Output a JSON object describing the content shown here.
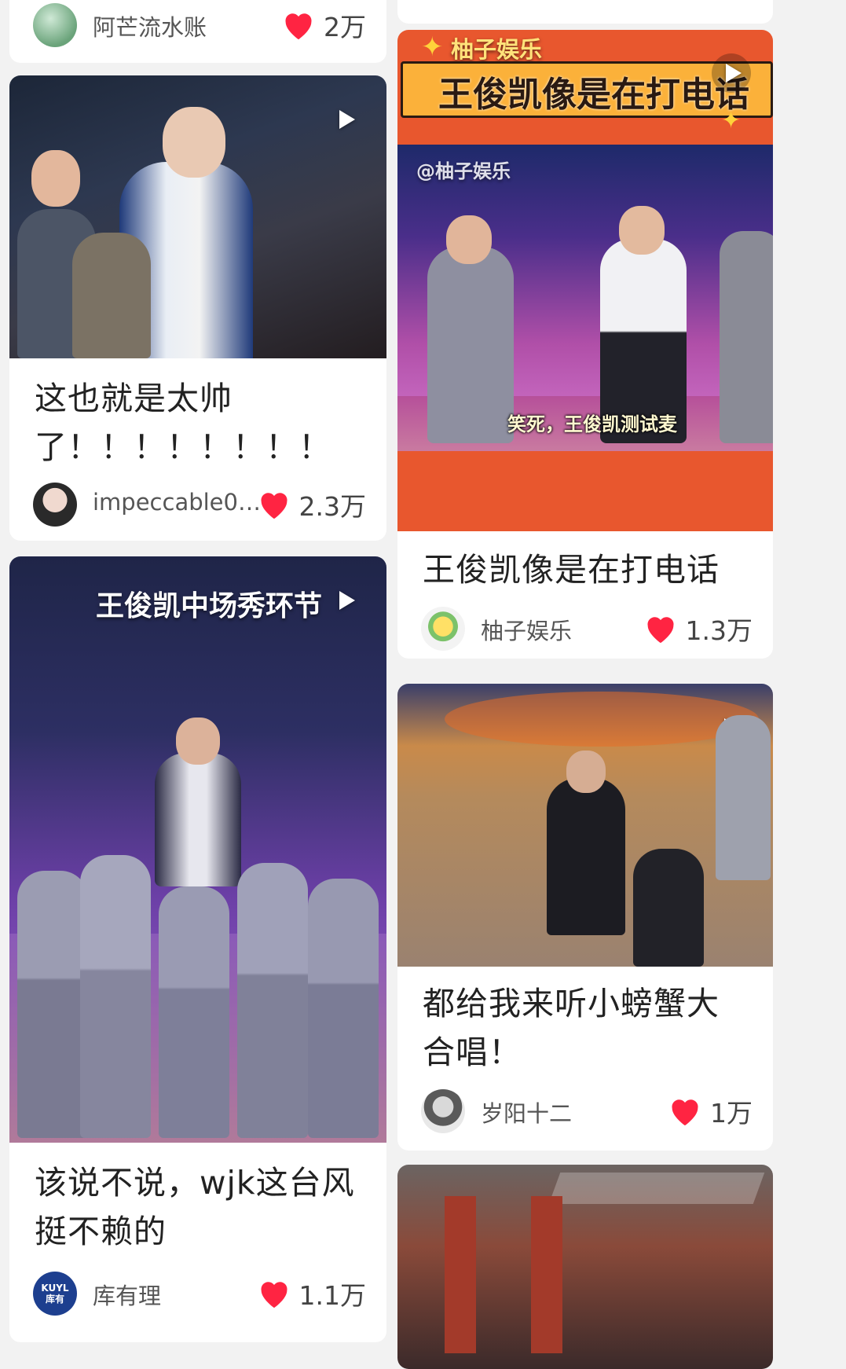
{
  "feed": {
    "top_left": {
      "author": "阿芒流水账",
      "likes": "2万"
    },
    "card1": {
      "title": "这也就是太帅了！！！！！！！！",
      "author": "impeccable09…",
      "likes": "2.3万"
    },
    "card2": {
      "brand": "柚子娱乐",
      "banner": "王俊凯像是在打电话",
      "watermark": "@柚子娱乐",
      "caption": "笑死，王俊凯测试麦",
      "title": "王俊凯像是在打电话",
      "author": "柚子娱乐",
      "likes": "1.3万"
    },
    "card3": {
      "overlay": "王俊凯中场秀环节",
      "title": "该说不说，wjk这台风挺不赖的",
      "author": "库有理",
      "avatar_text": "KUYL 库有",
      "likes": "1.1万"
    },
    "card4": {
      "title": "都给我来听小螃蟹大合唱！",
      "author": "岁阳十二",
      "likes": "1万"
    }
  },
  "colors": {
    "heart": "#ff2442",
    "brand_orange": "#e8572e"
  }
}
